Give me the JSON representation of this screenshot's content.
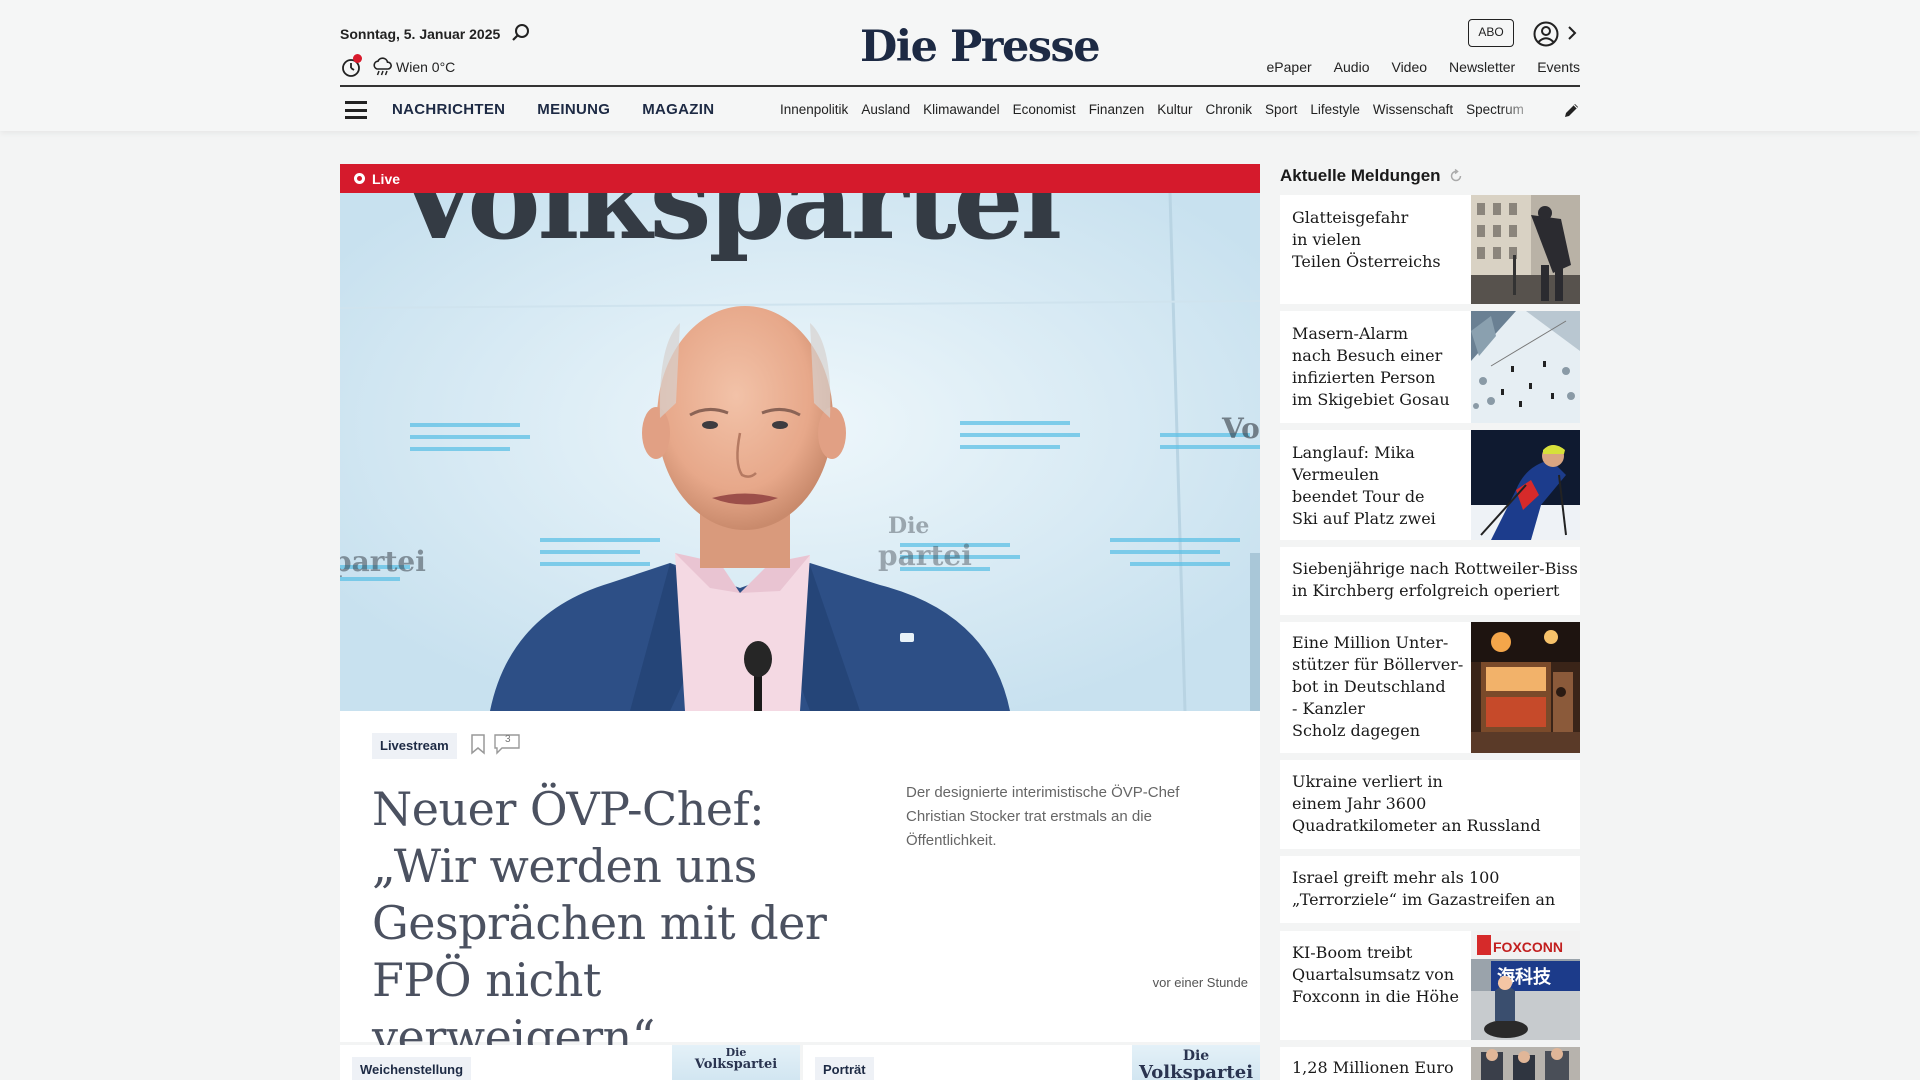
{
  "header": {
    "date": "Sonntag, 5. Januar 2025",
    "weather": "Wien 0°C",
    "logo": "Die Presse",
    "abo": "ABO",
    "top_links": [
      "ePaper",
      "Audio",
      "Video",
      "Newsletter",
      "Events"
    ],
    "main_nav": [
      "NACHRICHTEN",
      "MEINUNG",
      "MAGAZIN"
    ],
    "sub_nav": [
      "Innenpolitik",
      "Ausland",
      "Klimawandel",
      "Economist",
      "Finanzen",
      "Kultur",
      "Chronik",
      "Sport",
      "Lifestyle",
      "Wissenschaft",
      "Spectrum"
    ]
  },
  "lead": {
    "live_label": "Live",
    "image_text": "Volkspartei",
    "image_text_small": "Vo",
    "image_text_left": "partei",
    "image_text_mid": "Die",
    "image_text_mid2": "partei",
    "tag": "Livestream",
    "comments": "3",
    "headline": "Neuer ÖVP-Chef: „Wir werden uns Gesprächen mit der FPÖ nicht verweigern“",
    "teaser": "Der designierte interimistische ÖVP-Chef Christian Stocker trat erstmals an die Öffentlichkeit.",
    "time": "vor einer Stunde"
  },
  "cards": [
    {
      "tag": "Weichenstellung",
      "img_top": "Die",
      "img_text": "Volkspartei"
    },
    {
      "tag": "Porträt",
      "img_top": "Die",
      "img_text": "Volkspartei"
    }
  ],
  "sidebar": {
    "title": "Aktuelle Meldungen",
    "items": [
      {
        "text": "Glatteisgefahr\nin vielen\nTeilen Österreichs"
      },
      {
        "text": "Masern-Alarm\nnach Besuch einer\ninfizierten Person\nim Skigebiet Gosau"
      },
      {
        "text": "Langlauf: Mika\nVermeulen\nbeendet Tour de\nSki auf Platz zwei"
      },
      {
        "text": "Siebenjährige nach Rottweiler-Biss\nin Kirchberg erfolgreich operiert"
      },
      {
        "text": "Eine Million Unter-\nstützer für Böllerver-\nbot in Deutschland\n- Kanzler\nScholz dagegen"
      },
      {
        "text": "Ukraine verliert in\neinem Jahr 3600\nQuadratkilometer an Russland"
      },
      {
        "text": "Israel greift mehr als 100\n„Terrorziele“ im Gazastreifen an"
      },
      {
        "text": "KI-Boom treibt\nQuartalsumsatz von\nFoxconn in die Höhe",
        "thumb_text": "FOXCONN",
        "thumb_text2": "海科技"
      },
      {
        "text": "1,28 Millionen Euro"
      }
    ]
  },
  "colors": {
    "brand": "#1d2a44",
    "live": "#d51a2c",
    "background": "#f3f4f4"
  }
}
